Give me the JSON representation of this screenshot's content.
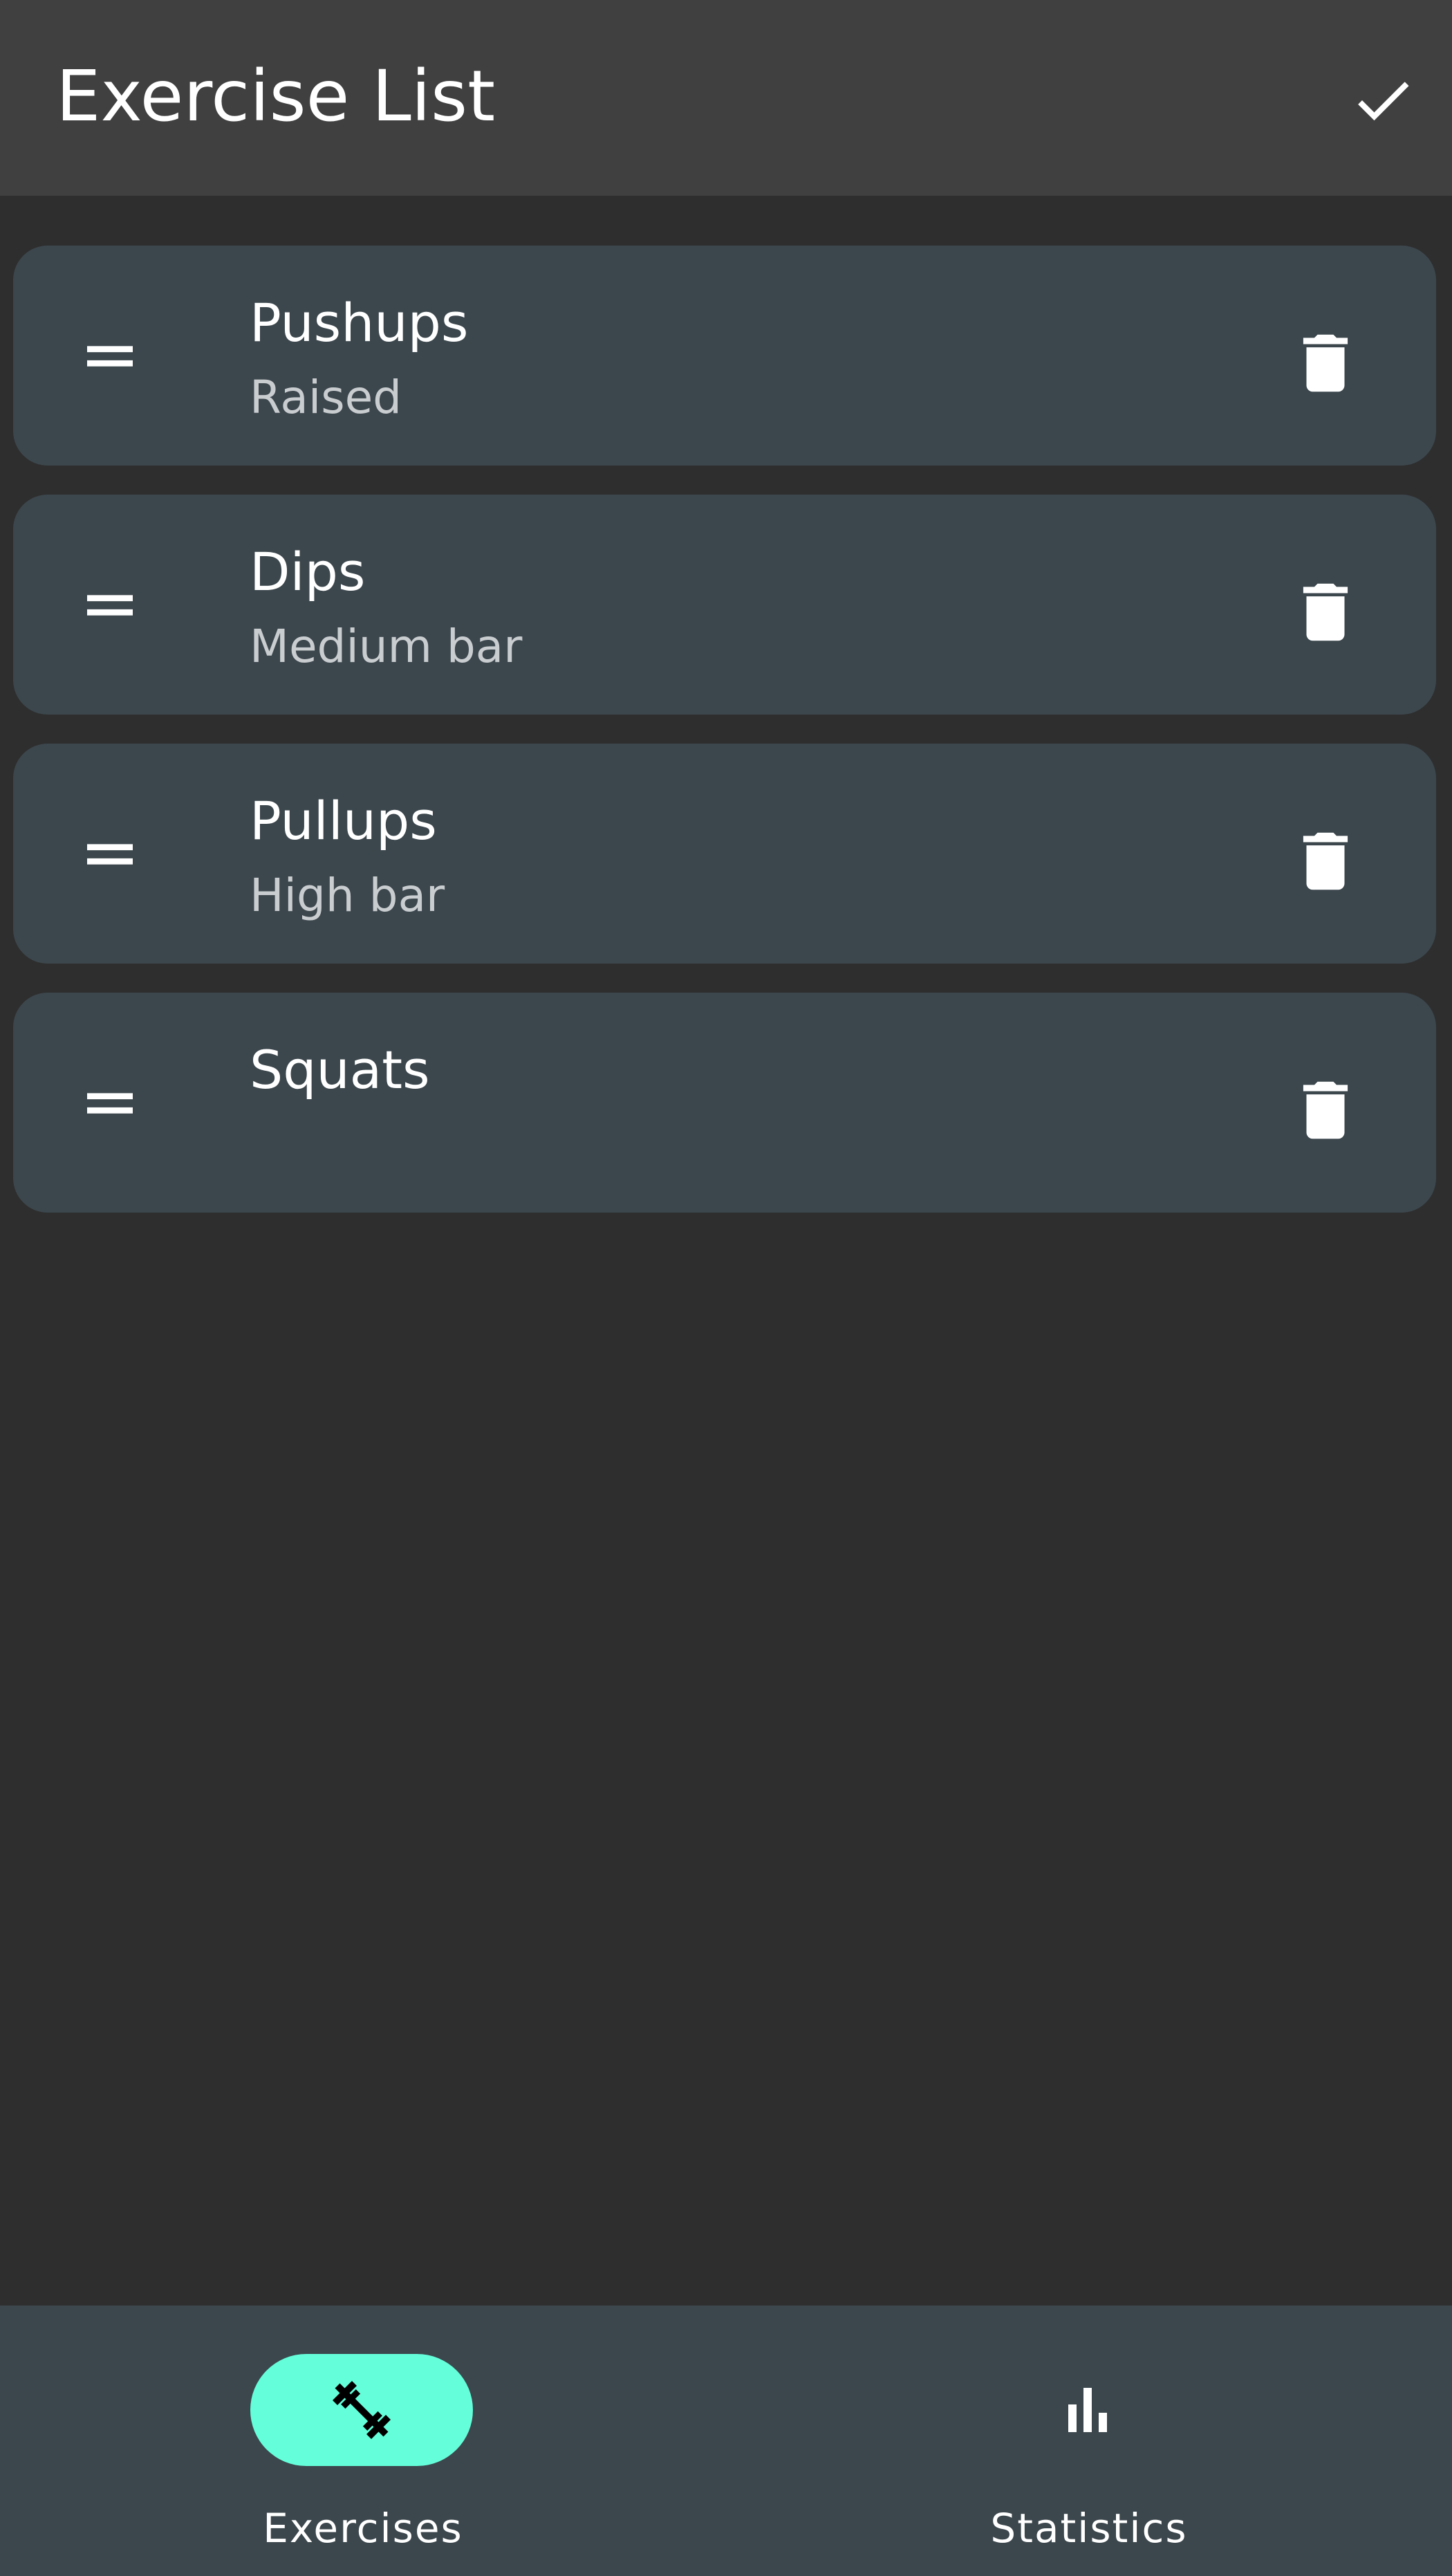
{
  "app_bar": {
    "title": "Exercise List",
    "done_icon": "check-icon"
  },
  "exercises": [
    {
      "name": "Pushups",
      "variant": "Raised"
    },
    {
      "name": "Dips",
      "variant": "Medium bar"
    },
    {
      "name": "Pullups",
      "variant": "High bar"
    },
    {
      "name": "Squats",
      "variant": ""
    }
  ],
  "bottom_nav": {
    "items": [
      {
        "label": "Exercises",
        "icon": "barbell-icon",
        "active": true
      },
      {
        "label": "Statistics",
        "icon": "bar-chart-icon",
        "active": false
      }
    ]
  },
  "colors": {
    "background": "#2e2e2e",
    "app_bar": "#404040",
    "card": "#3c474d",
    "accent": "#64ffda",
    "text_primary": "#ffffff",
    "text_secondary": "#c9cdd0"
  }
}
